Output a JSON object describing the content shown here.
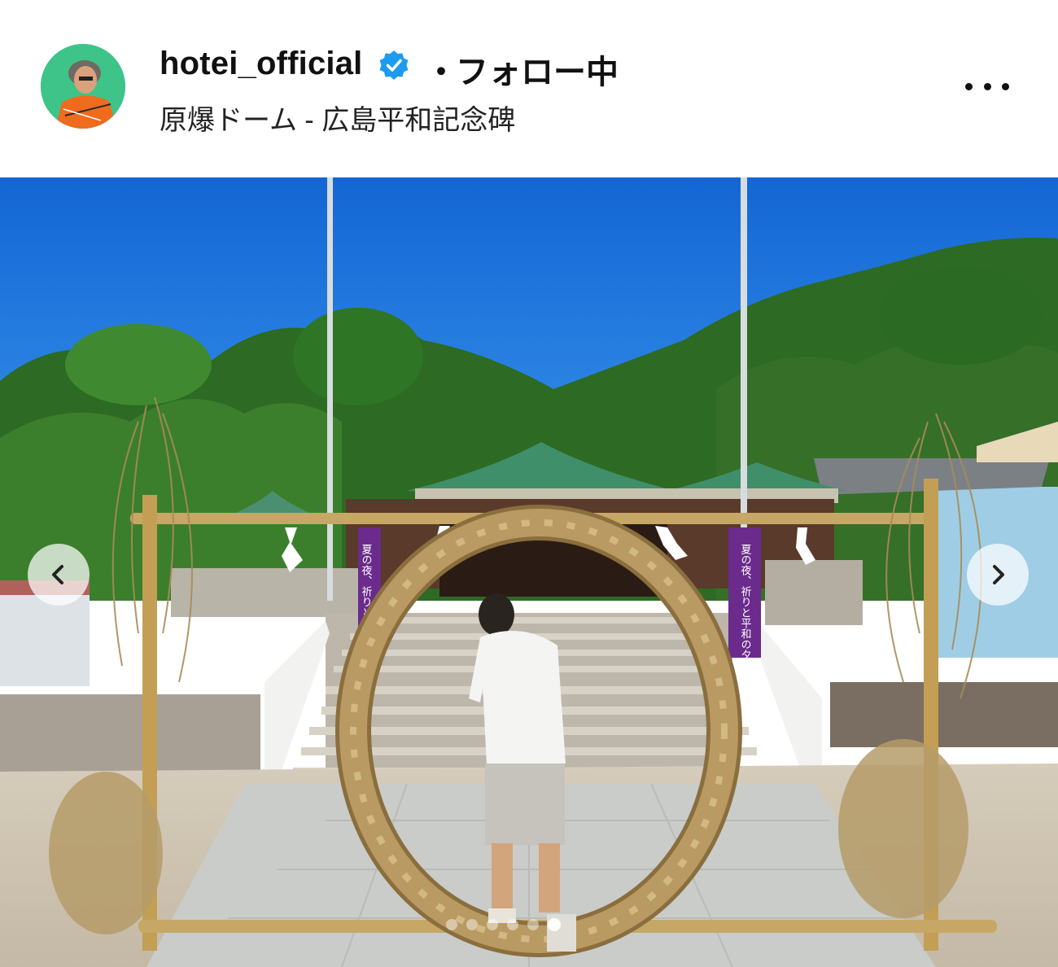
{
  "post_header": {
    "username": "hotei_official",
    "verified_icon": "verified-badge-icon",
    "separator": "・",
    "follow_status": "フォロー中",
    "location": "原爆ドーム - 広島平和記念碑",
    "more_icon": "more-options-icon"
  },
  "photo": {
    "banner_left_text": "夏の夜、祈りと平和の夕べ",
    "banner_right_text": "夏の夜、祈りと平和の夕べ"
  },
  "carousel": {
    "prev_icon": "chevron-left-icon",
    "next_icon": "chevron-right-icon",
    "slide_count": 6,
    "active_index": 5
  },
  "colors": {
    "avatar_bg": "#3ec489",
    "verified_blue": "#1d9bf0",
    "sky": "#1a7be0"
  }
}
